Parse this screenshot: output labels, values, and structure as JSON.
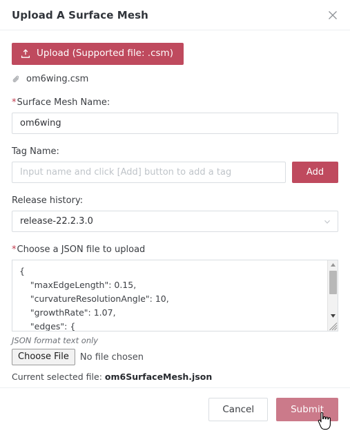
{
  "dialog": {
    "title": "Upload A Surface Mesh",
    "close_icon": "close-icon"
  },
  "upload": {
    "button_label": "Upload (Supported file: .csm)",
    "button_icon": "upload-icon",
    "selected_file": "om6wing.csm",
    "file_icon": "paperclip-icon",
    "accent_color": "#bf4a5e"
  },
  "surface_mesh_name": {
    "required_marker": "*",
    "label": "Surface Mesh Name:",
    "value": "om6wing"
  },
  "tag": {
    "label": "Tag Name:",
    "placeholder": "Input name and click [Add] button to add a tag",
    "value": "",
    "add_label": "Add"
  },
  "release": {
    "label": "Release history:",
    "selected": "release-22.2.3.0",
    "chevron_icon": "chevron-down-icon"
  },
  "json_file": {
    "required_marker": "*",
    "label": "Choose a JSON file to upload",
    "content": "{\n    \"maxEdgeLength\": 0.15,\n    \"curvatureResolutionAngle\": 10,\n    \"growthRate\": 1.07,\n    \"edges\": {",
    "hint": "JSON format text only",
    "choose_button_label": "Choose File",
    "no_file_label": "No file chosen",
    "current_file_label": "Current selected file:",
    "current_file_name": "om6SurfaceMesh.json"
  },
  "footer": {
    "cancel_label": "Cancel",
    "submit_label": "Submit",
    "submit_color": "#cb7a8a"
  }
}
